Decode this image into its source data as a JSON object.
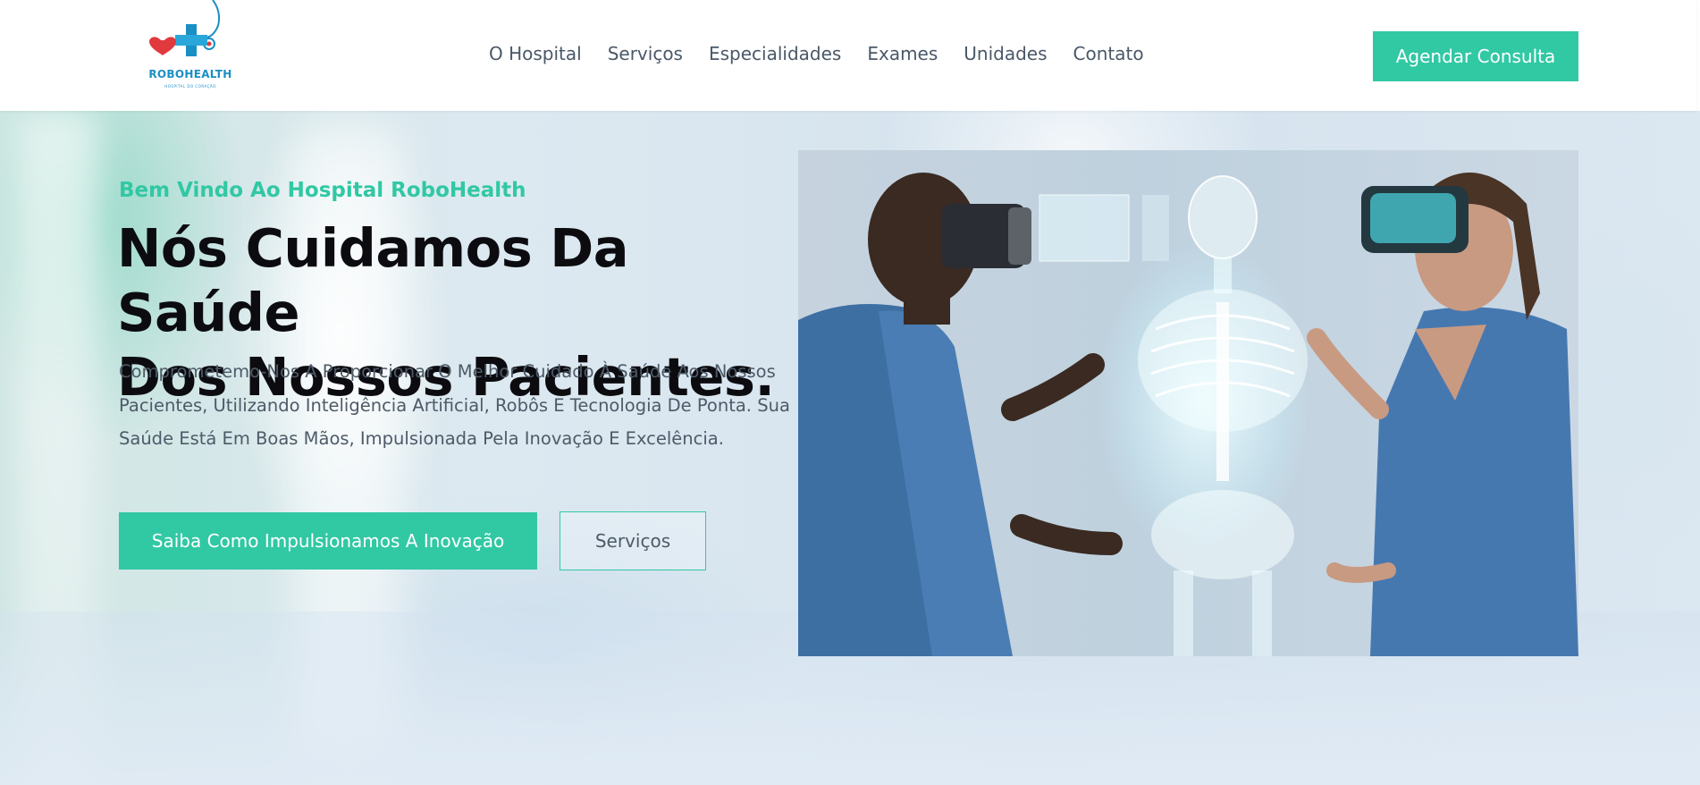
{
  "brand": {
    "name": "ROBOHEALTH",
    "tagline": "HOSPITAL DO CORAÇÃO",
    "colors": {
      "accent": "#31c8a4",
      "logo_blue": "#1a8fc4",
      "logo_red": "#e0393e"
    }
  },
  "nav": {
    "items": [
      "O Hospital",
      "Serviços",
      "Especialidades",
      "Exames",
      "Unidades",
      "Contato"
    ],
    "cta_label": "Agendar Consulta"
  },
  "hero": {
    "eyebrow": "Bem Vindo Ao Hospital RoboHealth",
    "headline_line1": "Nós Cuidamos Da Saúde",
    "headline_line2": "Dos Nossos Pacientes.",
    "description": "Comprometemo-Nos A Proporcionar O Melhor Cuidado À Saúde Aos Nossos Pacientes, Utilizando Inteligência Artificial, Robôs E Tecnologia De Ponta. Sua Saúde Está Em Boas Mãos, Impulsionada Pela Inovação E Excelência.",
    "primary_button": "Saiba Como Impulsionamos A Inovação",
    "secondary_button": "Serviços",
    "image_icon": "vr-doctors-hologram-image"
  }
}
